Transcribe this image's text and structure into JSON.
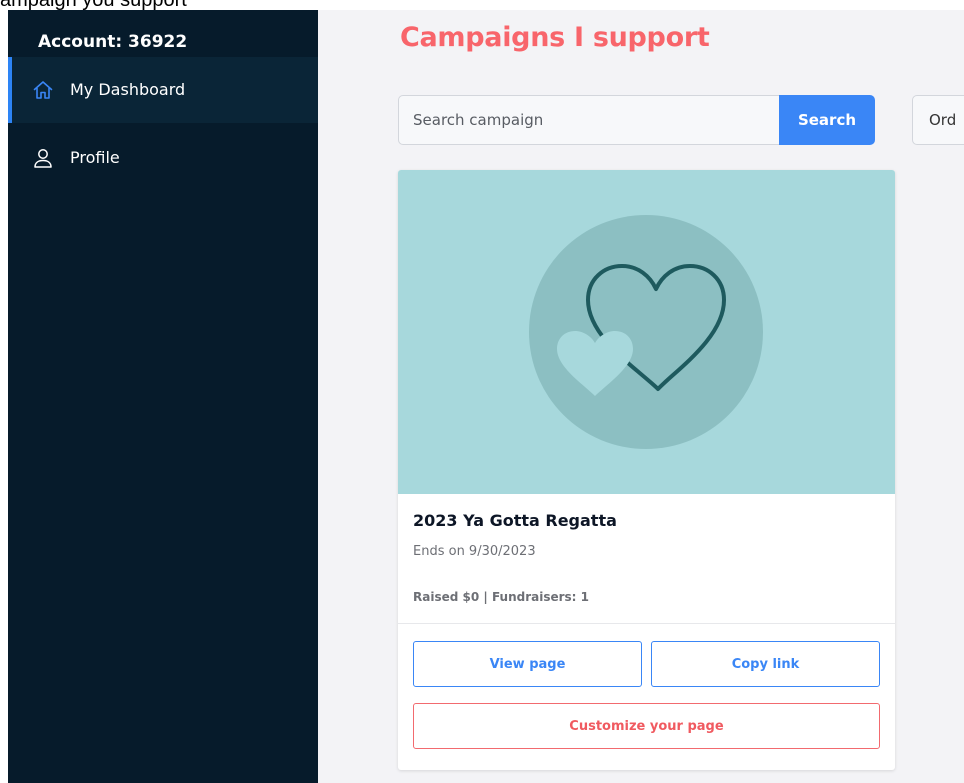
{
  "top_strip": {
    "text": "ampaign you support"
  },
  "sidebar": {
    "account_label": "Account: 36922",
    "items": [
      {
        "label": "My Dashboard",
        "icon": "home-icon",
        "active": true
      },
      {
        "label": "Profile",
        "icon": "user-icon",
        "active": false
      }
    ]
  },
  "main": {
    "title": "Campaigns I support",
    "search": {
      "placeholder": "Search campaign",
      "value": "",
      "button_label": "Search"
    },
    "order_label": "Ord"
  },
  "campaign": {
    "title": "2023 Ya Gotta Regatta",
    "ends": "Ends on 9/30/2023",
    "stats": "Raised $0 | Fundraisers: 1",
    "image_icon": "hearts-icon",
    "buttons": {
      "view": "View page",
      "copy": "Copy link",
      "customize": "Customize your page"
    }
  },
  "colors": {
    "sidebar_bg": "#061b2b",
    "accent_blue": "#3a86f6",
    "title_coral": "#f8656b",
    "image_bg": "#a7d8dc"
  }
}
